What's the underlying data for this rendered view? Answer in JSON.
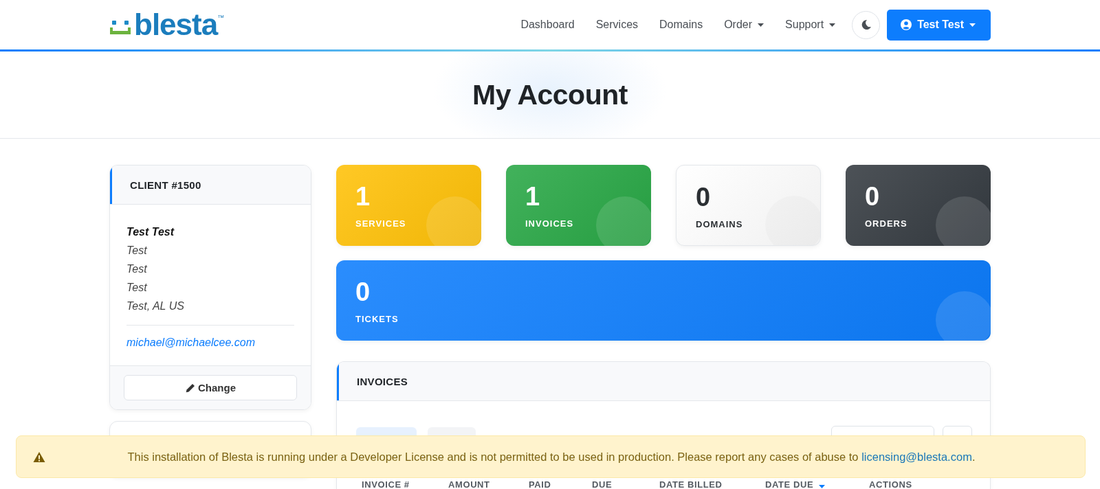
{
  "header": {
    "logo": {
      "text": "blesta",
      "mark": "™"
    },
    "nav": [
      {
        "label": "Dashboard",
        "dropdown": false
      },
      {
        "label": "Services",
        "dropdown": false
      },
      {
        "label": "Domains",
        "dropdown": false
      },
      {
        "label": "Order",
        "dropdown": true
      },
      {
        "label": "Support",
        "dropdown": true
      }
    ],
    "user_menu": {
      "label": "Test Test"
    }
  },
  "page_title": "My Account",
  "client_card": {
    "title": "CLIENT #1500",
    "name": "Test Test",
    "address": [
      "Test",
      "Test",
      "Test",
      "Test, AL US"
    ],
    "email": "michael@michaelcee.com",
    "button": "Change"
  },
  "stats": [
    {
      "value": "1",
      "label": "SERVICES",
      "color": "#ffc107"
    },
    {
      "value": "1",
      "label": "INVOICES",
      "color": "#28a745"
    },
    {
      "value": "0",
      "label": "DOMAINS",
      "color": "#ffffff"
    },
    {
      "value": "0",
      "label": "ORDERS",
      "color": "#343a40"
    }
  ],
  "tickets_card": {
    "value": "0",
    "label": "TICKETS",
    "color": "#0d7dfd"
  },
  "invoices": {
    "title": "INVOICES",
    "tabs": [
      {
        "selected": true
      },
      {
        "selected": false
      }
    ],
    "columns": [
      {
        "label": "INVOICE #",
        "sorted": false
      },
      {
        "label": "AMOUNT",
        "sorted": false
      },
      {
        "label": "PAID",
        "sorted": false
      },
      {
        "label": "DUE",
        "sorted": false
      },
      {
        "label": "DATE BILLED",
        "sorted": false
      },
      {
        "label": "DATE DUE",
        "sorted": true
      },
      {
        "label": "ACTIONS",
        "sorted": false
      }
    ]
  },
  "notice": {
    "text": "This installation of Blesta is running under a Developer License and is not permitted to be used in production. Please report any cases of abuse to ",
    "link": "licensing@blesta.com",
    "end": "."
  }
}
